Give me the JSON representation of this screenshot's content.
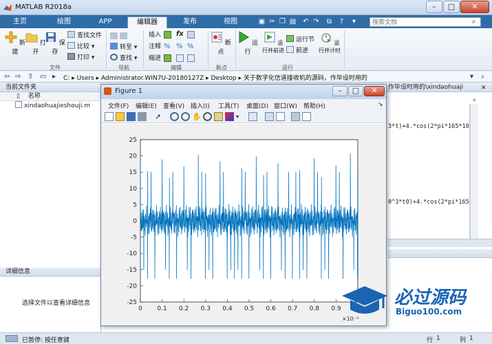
{
  "window": {
    "title": "MATLAB R2018a"
  },
  "tabs": [
    "主页",
    "绘图",
    "APP",
    "编辑器",
    "发布",
    "视图"
  ],
  "search": {
    "placeholder": "搜索文档"
  },
  "ribbon": {
    "file": {
      "new": "新建",
      "open": "打开",
      "save": "保存",
      "find_files": "查找文件",
      "compare": "比较",
      "print": "打印",
      "group": "文件"
    },
    "navigate": {
      "goto": "转至",
      "find": "查找",
      "group": "导航"
    },
    "edit": {
      "insert": "插入",
      "comment": "注释",
      "indent": "缩进",
      "fx": "fx",
      "group": "编辑"
    },
    "breakpoints": {
      "label": "断点",
      "group": "断点"
    },
    "run": {
      "run": "运行",
      "run_advance": "运行并前进",
      "run_section": "运行节",
      "advance": "前进",
      "run_time": "运行并计时",
      "group": "运行"
    }
  },
  "address": {
    "segments": [
      "C:",
      "Users",
      "Administrator.WIN7U-20180127Z",
      "Desktop",
      "关于数字化信道接收机的源码，作毕设时用的"
    ]
  },
  "left_panel": {
    "header": "当前文件夹",
    "column_name": "名称",
    "files": [
      "xindaohuajieshouji.m"
    ],
    "details_header": "详细信息",
    "details_hint": "选择文件以查看详细信息"
  },
  "editor": {
    "path_tail": "作毕设时用的\\xindaohuaji",
    "line1": "3*t)+4.*cos(2*pi*165*10",
    "line2": "0^3*t0)+4.*cos(2*pi*165"
  },
  "figure": {
    "title": "Figure 1",
    "menus": [
      "文件(F)",
      "编辑(E)",
      "查看(V)",
      "插入(I)",
      "工具(T)",
      "桌面(D)",
      "窗口(W)",
      "帮助(H)"
    ]
  },
  "status": {
    "text": "已暂停: 按任意键",
    "row_label": "行",
    "row_value": "1",
    "col_label": "列",
    "col_value": "1"
  },
  "watermark": {
    "cn": "必过源码",
    "url": "Biguo100.com"
  },
  "chart_data": {
    "type": "line",
    "title": "",
    "xlabel": "",
    "ylabel": "",
    "x_multiplier": "×10⁻³",
    "xlim": [
      0,
      1
    ],
    "ylim": [
      -25,
      25
    ],
    "xticks": [
      0,
      0.1,
      0.2,
      0.3,
      0.4,
      0.5,
      0.6,
      0.7,
      0.8,
      0.9
    ],
    "yticks": [
      25,
      20,
      15,
      10,
      5,
      0,
      -5,
      -10,
      -15,
      -20,
      -25
    ],
    "grid": false,
    "series": [
      {
        "color": "#0072bd",
        "description": "periodic signal centered at 0 with baseline oscillation about ±4 and sharp spikes reaching about +21 and -21",
        "peak_period_ms": 0.0333,
        "peak_amplitude": 21,
        "baseline_amplitude": 4
      }
    ]
  }
}
